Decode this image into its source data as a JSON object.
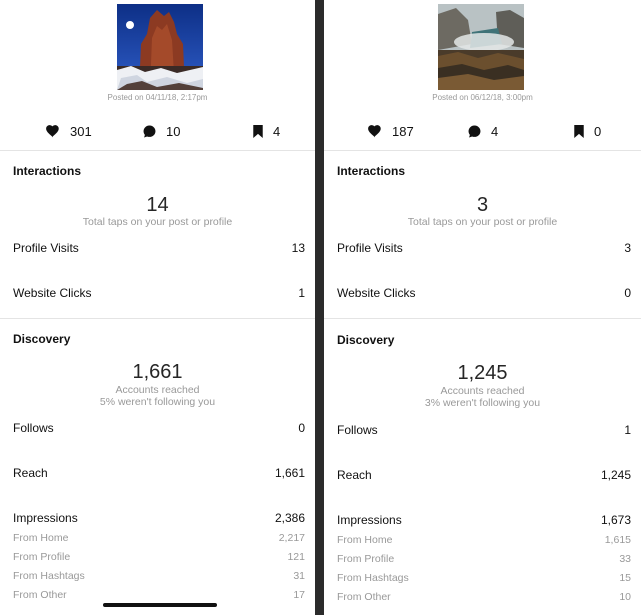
{
  "left": {
    "posted": "Posted on 04/11/18, 2:17pm",
    "likes": "301",
    "comments": "10",
    "saves": "4",
    "interactions_title": "Interactions",
    "interactions_total": "14",
    "interactions_sub": "Total taps on your post or profile",
    "profile_visits_label": "Profile Visits",
    "profile_visits": "13",
    "website_clicks_label": "Website Clicks",
    "website_clicks": "1",
    "discovery_title": "Discovery",
    "accounts_reached": "1,661",
    "accounts_reached_label": "Accounts reached",
    "not_following": "5% weren't following you",
    "follows_label": "Follows",
    "follows": "0",
    "reach_label": "Reach",
    "reach": "1,661",
    "impressions_label": "Impressions",
    "impressions": "2,386",
    "from_home_label": "From Home",
    "from_home": "2,217",
    "from_profile_label": "From Profile",
    "from_profile": "121",
    "from_hashtags_label": "From Hashtags",
    "from_hashtags": "31",
    "from_other_label": "From Other",
    "from_other": "17"
  },
  "right": {
    "posted": "Posted on 06/12/18, 3:00pm",
    "likes": "187",
    "comments": "4",
    "saves": "0",
    "interactions_title": "Interactions",
    "interactions_total": "3",
    "interactions_sub": "Total taps on your post or profile",
    "profile_visits_label": "Profile Visits",
    "profile_visits": "3",
    "website_clicks_label": "Website Clicks",
    "website_clicks": "0",
    "discovery_title": "Discovery",
    "accounts_reached": "1,245",
    "accounts_reached_label": "Accounts reached",
    "not_following": "3% weren't following you",
    "follows_label": "Follows",
    "follows": "1",
    "reach_label": "Reach",
    "reach": "1,245",
    "impressions_label": "Impressions",
    "impressions": "1,673",
    "from_home_label": "From Home",
    "from_home": "1,615",
    "from_profile_label": "From Profile",
    "from_profile": "33",
    "from_hashtags_label": "From Hashtags",
    "from_hashtags": "15",
    "from_other_label": "From Other",
    "from_other": "10"
  },
  "icons": {
    "like": "heart-icon",
    "comment": "comment-bubble-icon",
    "save": "bookmark-icon"
  }
}
